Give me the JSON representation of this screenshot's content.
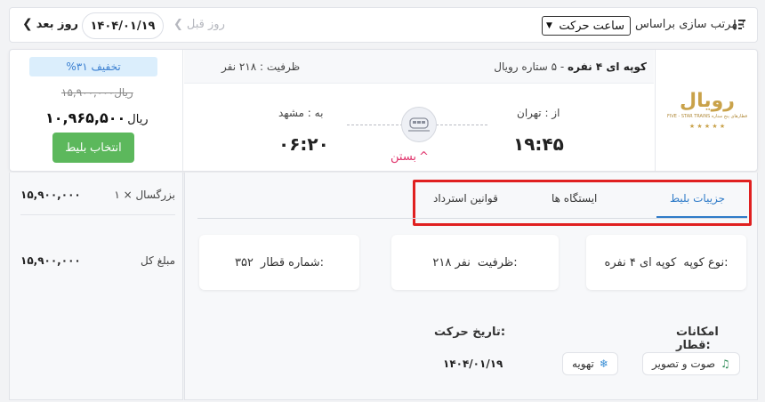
{
  "topbar": {
    "next_day": "روز بعد",
    "date": "۱۴۰۴/۰۱/۱۹",
    "prev_day": "روز قبل",
    "sort_label": "مرتب سازی براساس :",
    "sort_value": "ساعت حرکت"
  },
  "card": {
    "discount": "%۳۱ تخفیف",
    "old_price": "۱۵,۹۰۰,۰۰۰ریال",
    "new_price_amount": "۱۰,۹۶۵,۵۰۰",
    "new_price_currency": "ریال",
    "select_button": "انتخاب بلیط",
    "capacity": "ظرفیت : ۲۱۸ نفر",
    "wagon_type": "کوپه ای ۴ نفره",
    "wagon_rating": " - ۵ ستاره رویال",
    "from_label": "از : تهران",
    "departure_time": "۱۹:۴۵",
    "to_label": "به : مشهد",
    "arrival_time": "۰۶:۲۰",
    "close_link": "بستن",
    "logo_text": "رویال",
    "logo_subtext": "FIVE - STAR TRAINS  قطارهای پنج ستاره"
  },
  "summary": {
    "passenger_label": "بزرگسال × ۱",
    "passenger_value": "۱۵,۹۰۰,۰۰۰",
    "total_label": "مبلغ کل",
    "total_value": "۱۵,۹۰۰,۰۰۰"
  },
  "tabs": [
    {
      "label": "جزییات بلیط",
      "active": true
    },
    {
      "label": "ایستگاه ها",
      "active": false
    },
    {
      "label": "قوانین استرداد",
      "active": false
    }
  ],
  "details": {
    "wagon_type_label": "نوع کوپه:",
    "wagon_type_value": "کوپه ای ۴ نفره",
    "capacity_label": "ظرفیت:",
    "capacity_value": "۲۱۸ نفر",
    "train_number_label": "شماره قطار:",
    "train_number_value": "۳۵۲",
    "facilities_label": "امکانات قطار:",
    "date_label": "تاریخ حرکت:",
    "date_value": "۱۴۰۴/۰۱/۱۹",
    "facilities": [
      {
        "label": "صوت و تصویر",
        "icon": "music-note-icon"
      },
      {
        "label": "تهویه",
        "icon": "snowflake-icon"
      }
    ]
  },
  "colors": {
    "accent_blue": "#2f7bc8",
    "green_button": "#5cb85c",
    "close_pink": "#e0336b",
    "highlight_red": "#e02020",
    "logo_gold": "#c9a24a"
  }
}
